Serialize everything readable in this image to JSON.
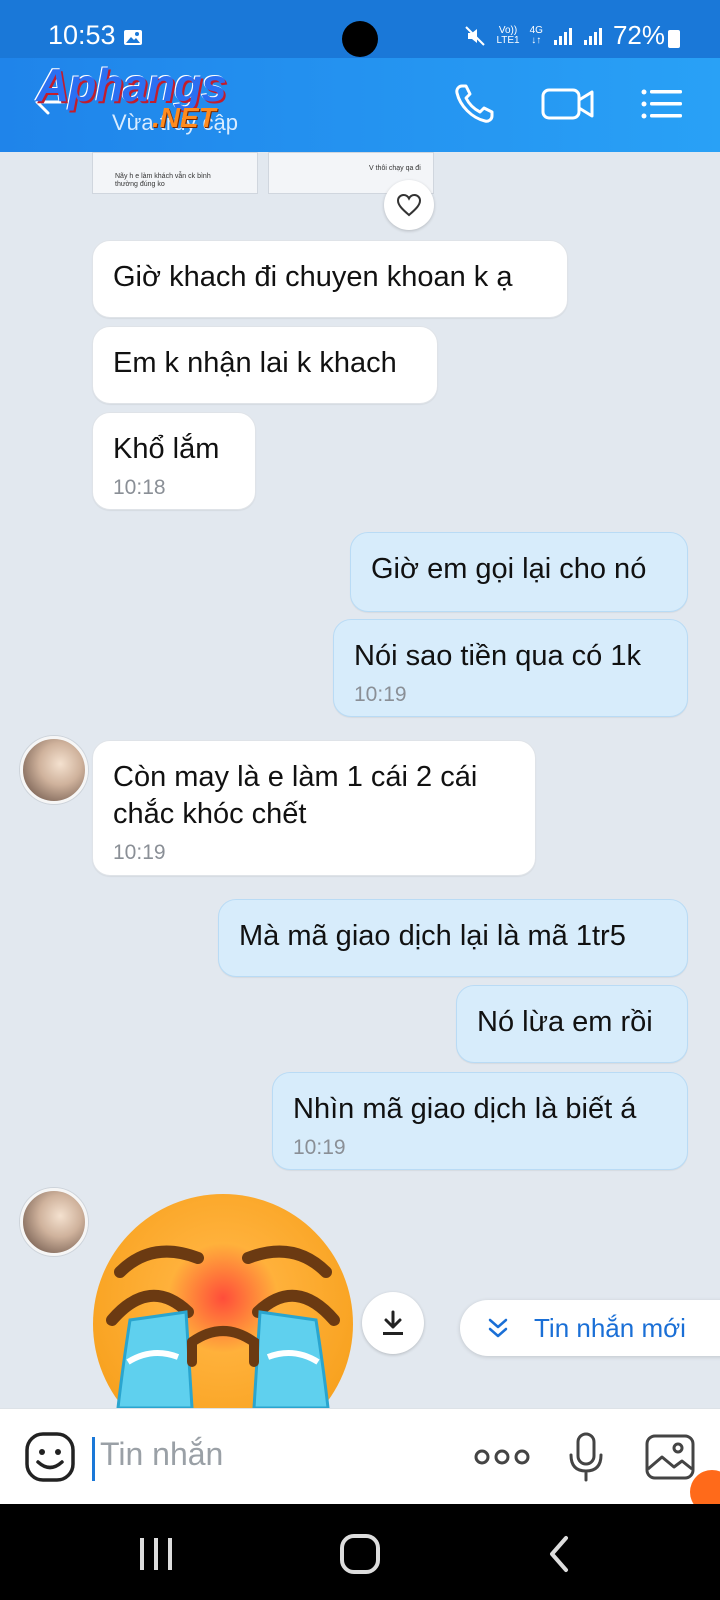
{
  "status": {
    "time": "10:53",
    "network_top": "Vo))",
    "network_bottom": "LTE1",
    "net_type": "4G",
    "battery": "72%"
  },
  "header": {
    "logo_text": "Aphangs",
    "logo_suffix": ".NET",
    "status_text": "Vừa truy cập"
  },
  "thumbnail": {
    "left_caption": "Nãy h e làm khách vẫn ck bình thường đúng ko",
    "right_caption": "V thôi chạy qa đi"
  },
  "messages": [
    {
      "side": "in",
      "text": "Giờ khach đi chuyen khoan k ạ",
      "time": ""
    },
    {
      "side": "in",
      "text": "Em k nhận lai k khach",
      "time": ""
    },
    {
      "side": "in",
      "text": "Khổ lắm",
      "time": "10:18"
    },
    {
      "side": "out",
      "text": "Giờ em gọi lại cho nó",
      "time": ""
    },
    {
      "side": "out",
      "text": "Nói sao tiền qua có 1k",
      "time": "10:19"
    },
    {
      "side": "in",
      "text": "Còn may là e làm 1 cái 2 cái chắc khóc chết",
      "time": "10:19"
    },
    {
      "side": "out",
      "text": "Mà mã giao dịch lại là mã 1tr5",
      "time": ""
    },
    {
      "side": "out",
      "text": "Nó lừa em rồi",
      "time": ""
    },
    {
      "side": "out",
      "text": "Nhìn mã giao dịch là biết á",
      "time": "10:19"
    }
  ],
  "new_messages_label": "Tin nhắn mới",
  "composer": {
    "placeholder": "Tin nhắn"
  },
  "colors": {
    "header": "#1f84ea",
    "incoming_bubble": "#ffffff",
    "outgoing_bubble": "#d7ecfb",
    "chat_background": "#e2e8ef",
    "accent": "#1a6fd6"
  },
  "icons": [
    "back-arrow-icon",
    "phone-icon",
    "video-call-icon",
    "menu-icon",
    "heart-icon",
    "download-icon",
    "chevron-down-icon",
    "sticker-icon",
    "more-icon",
    "microphone-icon",
    "image-icon"
  ]
}
